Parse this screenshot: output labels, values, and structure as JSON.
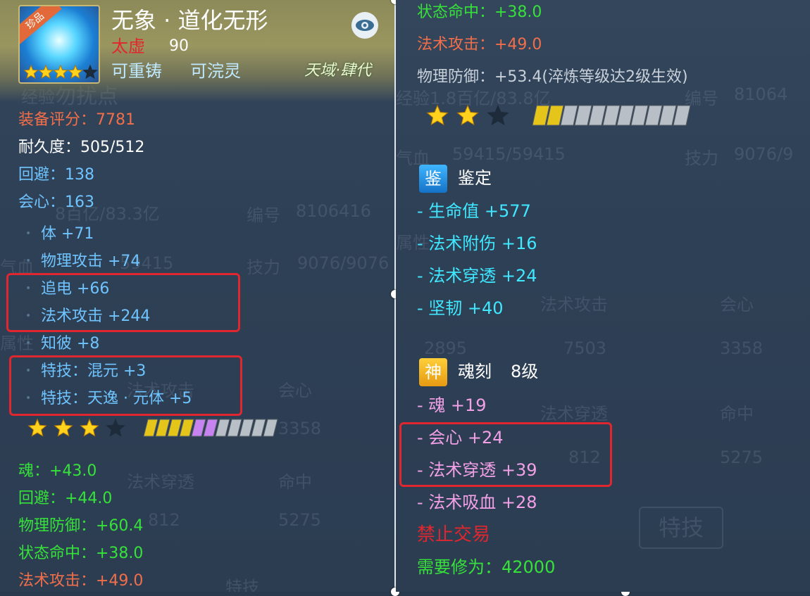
{
  "colors": {
    "orange": "#f06f4a",
    "white": "#ffffff",
    "blue": "#6fc4ff",
    "green": "#36e23a",
    "cyan": "#3fe7ff",
    "pink": "#f1a0e6",
    "red": "#e0262e",
    "gray": "#c8d0da"
  },
  "item": {
    "name": "无象 · 道化无形",
    "tier": "太虚",
    "level": "90",
    "recast": "可重铸",
    "reforge": "可浣灵",
    "realm": "天域·肆代",
    "rarity_badge": "珍品",
    "icon_stars": 4
  },
  "left": {
    "score": "装备评分：7781",
    "durability": "耐久度：505/512",
    "attrs": [
      "回避：138",
      "会心：163"
    ],
    "sub": [
      "体 +71",
      "物理攻击 +74",
      "追电 +66",
      "法术攻击 +244",
      "知彼 +8",
      "特技：混元 +3",
      "特技：天逸 · 元体 +5"
    ],
    "rating": {
      "stars_filled": 3,
      "stars_total": 4,
      "bars_gold": 4,
      "bars_purple": 2,
      "bars_total": 11
    },
    "green": [
      "魂：+43.0",
      "回避：+44.0",
      "物理防御：+60.4",
      "状态命中：+38.0",
      "法术攻击：+49.0"
    ],
    "ghost": [
      "经验",
      "勿扰点",
      "8百亿/83.3亿",
      "编号",
      "8106416",
      "气血",
      "59415",
      "技力",
      "9076/9076",
      "属性",
      "法术攻击",
      "会心",
      "3358",
      "法术穿透",
      "命中",
      "812",
      "5275",
      "特技"
    ]
  },
  "right": {
    "top": {
      "status_hit": "状态命中：+38.0",
      "magic_atk": "法术攻击：+49.0",
      "phys_def": "物理防御：+53.4(淬炼等级达2级生效)"
    },
    "rating": {
      "stars_filled": 2,
      "stars_total": 3,
      "bars_gold": 2,
      "bars_total": 11
    },
    "identify": {
      "badge": "鉴",
      "title": "鉴定",
      "items": [
        "- 生命值 +577",
        "- 法术附伤 +16",
        "- 法术穿透 +24",
        "- 坚韧 +40"
      ]
    },
    "soul": {
      "badge": "神",
      "title": "魂刻",
      "level": "8级",
      "items": [
        "- 魂 +19",
        "- 会心 +24",
        "- 法术穿透 +39",
        "- 法术吸血 +28"
      ]
    },
    "trade": "禁止交易",
    "req": "需要修为：42000",
    "ghost": [
      "经验",
      "1.8百亿/83.8亿",
      "编号",
      "81064",
      "气血",
      "59415/59415",
      "技力",
      "9076/9",
      "属性",
      "法术攻击",
      "会心",
      "2895",
      "7503",
      "3358",
      "法术穿透",
      "命中",
      "812",
      "5275",
      "特技"
    ]
  }
}
